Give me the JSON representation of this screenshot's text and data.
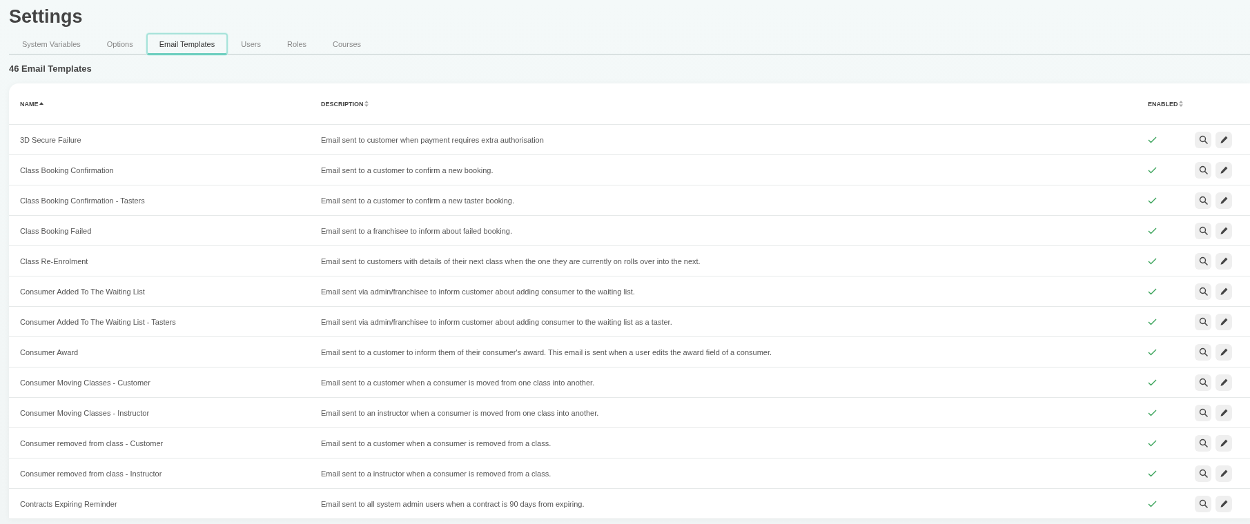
{
  "page": {
    "title": "Settings"
  },
  "tabs": [
    {
      "label": "System Variables",
      "selected": false
    },
    {
      "label": "Options",
      "selected": false
    },
    {
      "label": "Email Templates",
      "selected": true
    },
    {
      "label": "Users",
      "selected": false
    },
    {
      "label": "Roles",
      "selected": false
    },
    {
      "label": "Courses",
      "selected": false
    }
  ],
  "count_heading": "46 Email Templates",
  "table": {
    "columns": [
      {
        "label": "NAME",
        "sorted": true
      },
      {
        "label": "DESCRIPTION",
        "sorted": false
      },
      {
        "label": "ENABLED",
        "sorted": false
      }
    ],
    "rows": [
      {
        "name": "3D Secure Failure",
        "description": "Email sent to customer when payment requires extra authorisation",
        "enabled": true
      },
      {
        "name": "Class Booking Confirmation",
        "description": "Email sent to a customer to confirm a new booking.",
        "enabled": true
      },
      {
        "name": "Class Booking Confirmation - Tasters",
        "description": "Email sent to a customer to confirm a new taster booking.",
        "enabled": true
      },
      {
        "name": "Class Booking Failed",
        "description": "Email sent to a franchisee to inform about failed booking.",
        "enabled": true
      },
      {
        "name": "Class Re-Enrolment",
        "description": "Email sent to customers with details of their next class when the one they are currently on rolls over into the next.",
        "enabled": true
      },
      {
        "name": "Consumer Added To The Waiting List",
        "description": "Email sent via admin/franchisee to inform customer about adding consumer to the waiting list.",
        "enabled": true
      },
      {
        "name": "Consumer Added To The Waiting List - Tasters",
        "description": "Email sent via admin/franchisee to inform customer about adding consumer to the waiting list as a taster.",
        "enabled": true
      },
      {
        "name": "Consumer Award",
        "description": "Email sent to a customer to inform them of their consumer's award. This email is sent when a user edits the award field of a consumer.",
        "enabled": true
      },
      {
        "name": "Consumer Moving Classes - Customer",
        "description": "Email sent to a customer when a consumer is moved from one class into another.",
        "enabled": true
      },
      {
        "name": "Consumer Moving Classes - Instructor",
        "description": "Email sent to an instructor when a consumer is moved from one class into another.",
        "enabled": true
      },
      {
        "name": "Consumer removed from class - Customer",
        "description": "Email sent to a customer when a consumer is removed from a class.",
        "enabled": true
      },
      {
        "name": "Consumer removed from class - Instructor",
        "description": "Email sent to a instructor when a consumer is removed from a class.",
        "enabled": true
      },
      {
        "name": "Contracts Expiring Reminder",
        "description": "Email sent to all system admin users when a contract is 90 days from expiring.",
        "enabled": true
      }
    ]
  }
}
